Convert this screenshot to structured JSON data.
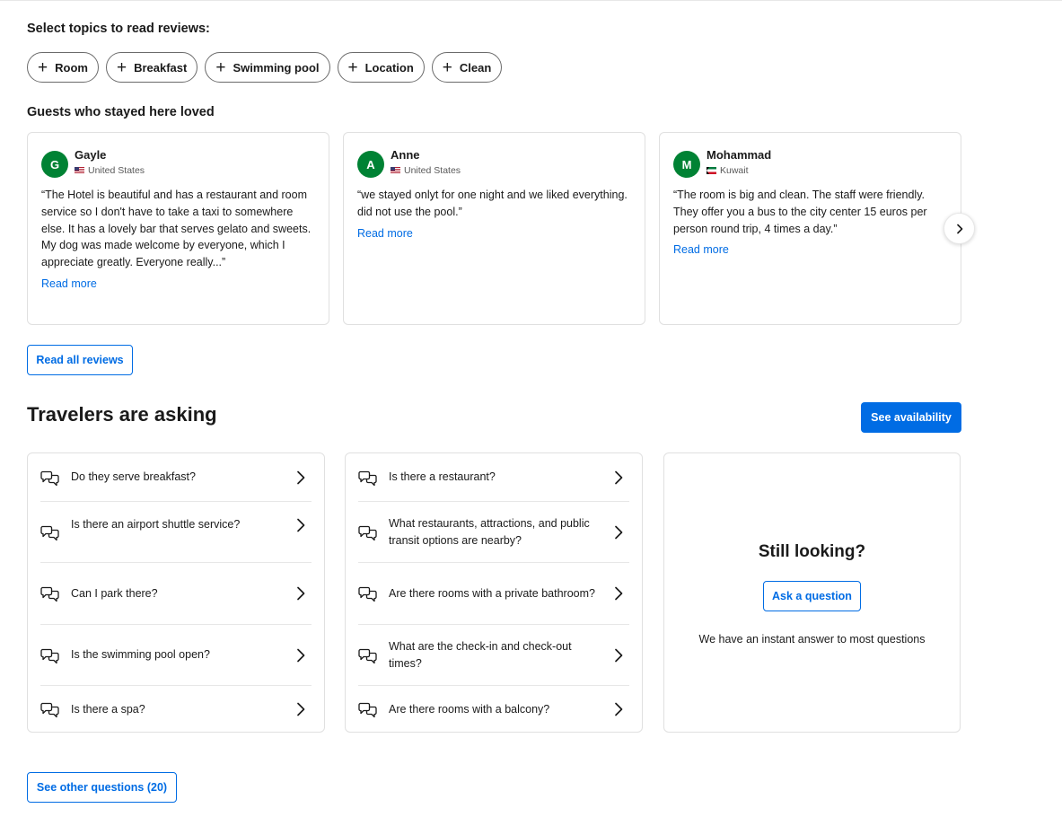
{
  "topics": {
    "heading": "Select topics to read reviews:",
    "chips": [
      "Room",
      "Breakfast",
      "Swimming pool",
      "Location",
      "Clean"
    ]
  },
  "reviews": {
    "heading": "Guests who stayed here loved",
    "cards": [
      {
        "initial": "G",
        "name": "Gayle",
        "country": "United States",
        "text": "“The Hotel is beautiful and has a restaurant and room service so I don't have to take a taxi to somewhere else. It has a lovely bar that serves gelato and sweets. My dog was made welcome by everyone, which I appreciate greatly. Everyone really...”",
        "read_more": "Read more"
      },
      {
        "initial": "A",
        "name": "Anne",
        "country": "United States",
        "text": "“we stayed onlyt for one night and we liked everything. did not use the pool.”",
        "read_more": "Read more"
      },
      {
        "initial": "M",
        "name": "Mohammad",
        "country": "Kuwait",
        "text": "“The room is big and clean. The staff were friendly. They offer you a bus to the city center 15 euros per person round trip, 4 times a day.”",
        "read_more": "Read more"
      }
    ],
    "read_all_label": "Read all reviews"
  },
  "asking": {
    "heading": "Travelers are asking",
    "availability_label": "See availability",
    "left_questions": [
      "Do they serve breakfast?",
      "Is there an airport shuttle service?",
      "Can I park there?",
      "Is the swimming pool open?",
      "Is there a spa?"
    ],
    "right_questions": [
      "Is there a restaurant?",
      "What restaurants, attractions, and public transit options are nearby?",
      "Are there rooms with a private bathroom?",
      "What are the check-in and check-out times?",
      "Are there rooms with a balcony?"
    ],
    "still_looking": {
      "title": "Still looking?",
      "ask_label": "Ask a question",
      "subtitle": "We have an instant answer to most questions"
    },
    "other_questions_label": "See other questions (20)"
  },
  "colors": {
    "accent": "#006ce4",
    "avatar": "#008234"
  }
}
